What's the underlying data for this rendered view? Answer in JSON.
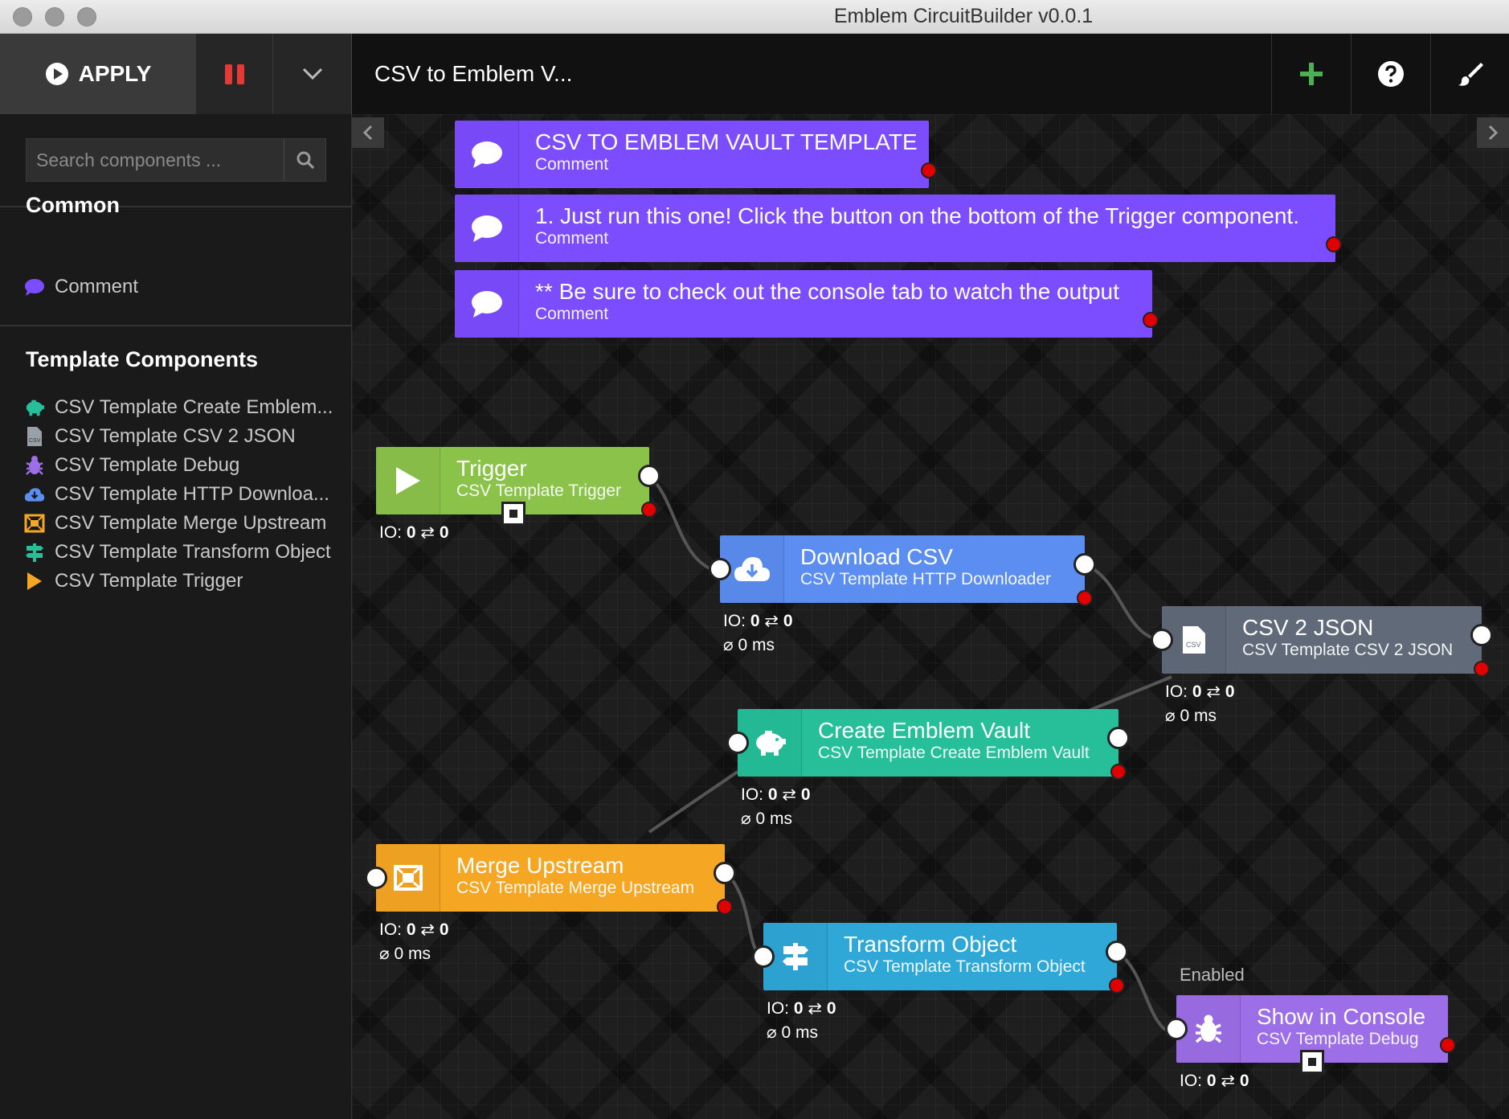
{
  "window": {
    "title": "Emblem CircuitBuilder v0.0.1"
  },
  "toolbar": {
    "apply_label": "APPLY",
    "circuit_title": "CSV to Emblem V..."
  },
  "colors": {
    "comment": "#7c4dff",
    "trigger": "#8bc34a",
    "download": "#5b8ef0",
    "csv2json": "#616a78",
    "vault": "#26bf9a",
    "merge": "#f5a623",
    "transform": "#2fa8d8",
    "debug": "#9c6ee8",
    "port_error": "#e00000",
    "add_icon": "#4caf50"
  },
  "sidebar": {
    "search_placeholder": "Search components ...",
    "common_title": "Common",
    "common_items": [
      {
        "label": "Comment",
        "icon": "comment-icon"
      }
    ],
    "template_title": "Template Components",
    "template_items": [
      {
        "label": "CSV Template Create Emblem...",
        "icon": "piggy-bank-icon"
      },
      {
        "label": "CSV Template CSV 2 JSON",
        "icon": "csv-file-icon"
      },
      {
        "label": "CSV Template Debug",
        "icon": "bug-icon"
      },
      {
        "label": "CSV Template HTTP Downloa...",
        "icon": "cloud-download-icon"
      },
      {
        "label": "CSV Template Merge Upstream",
        "icon": "merge-icon"
      },
      {
        "label": "CSV Template Transform Object",
        "icon": "signpost-icon"
      },
      {
        "label": "CSV Template Trigger",
        "icon": "play-icon"
      }
    ]
  },
  "canvas": {
    "comments": [
      {
        "title": "CSV TO EMBLEM VAULT TEMPLATE",
        "subtitle": "Comment"
      },
      {
        "title": "1. Just run this one! Click the button on the bottom of the Trigger component.",
        "subtitle": "Comment"
      },
      {
        "title": "** Be sure to check out the console tab to watch the output",
        "subtitle": "Comment"
      }
    ],
    "nodes": {
      "trigger": {
        "title": "Trigger",
        "subtitle": "CSV Template Trigger",
        "io_label": "IO:",
        "io_in": "0",
        "io_out": "0"
      },
      "download": {
        "title": "Download CSV",
        "subtitle": "CSV Template HTTP Downloader",
        "io_label": "IO:",
        "io_in": "0",
        "io_out": "0",
        "time": "0 ms"
      },
      "csv2json": {
        "title": "CSV 2 JSON",
        "subtitle": "CSV Template CSV 2 JSON",
        "io_label": "IO:",
        "io_in": "0",
        "io_out": "0",
        "time": "0 ms"
      },
      "vault": {
        "title": "Create Emblem Vault",
        "subtitle": "CSV Template Create Emblem Vault",
        "io_label": "IO:",
        "io_in": "0",
        "io_out": "0",
        "time": "0 ms"
      },
      "merge": {
        "title": "Merge Upstream",
        "subtitle": "CSV Template Merge Upstream",
        "io_label": "IO:",
        "io_in": "0",
        "io_out": "0",
        "time": "0 ms"
      },
      "transform": {
        "title": "Transform Object",
        "subtitle": "CSV Template Transform Object",
        "io_label": "IO:",
        "io_in": "0",
        "io_out": "0",
        "time": "0 ms"
      },
      "debug": {
        "title": "Show in Console",
        "subtitle": "CSV Template Debug",
        "io_label": "IO:",
        "io_in": "0",
        "io_out": "0",
        "status": "Enabled"
      }
    }
  }
}
